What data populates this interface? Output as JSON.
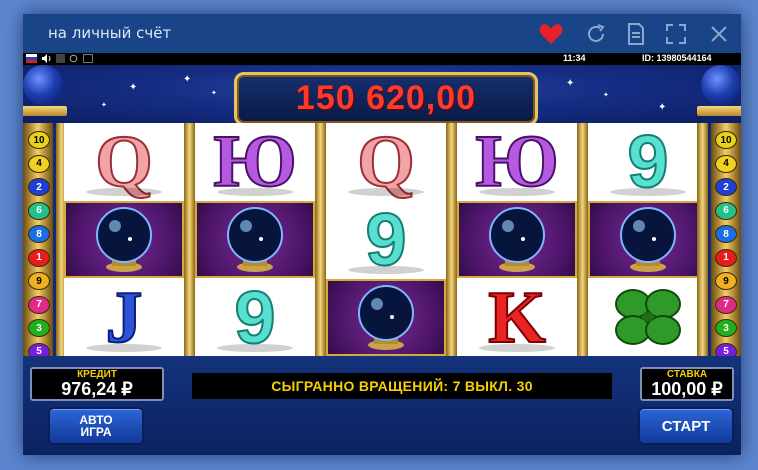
{
  "window": {
    "title": "на личный счёт",
    "icons": [
      "heart-icon",
      "refresh-icon",
      "document-icon",
      "fullscreen-icon",
      "close-icon"
    ],
    "heart_color": "#e8202a"
  },
  "statusbar": {
    "icons": [
      "russian-flag-icon",
      "sound-icon",
      "stop-icon",
      "reload-icon",
      "menu-icon"
    ],
    "time": "11:34",
    "id": "ID: 13980544164"
  },
  "game": {
    "jackpot": "150 620,00",
    "reels": [
      [
        "Q",
        "crystal-ball",
        "J"
      ],
      [
        "Ю",
        "crystal-ball",
        "9"
      ],
      [
        "Q",
        "9",
        "crystal-ball"
      ],
      [
        "Ю",
        "crystal-ball",
        "K"
      ],
      [
        "9",
        "crystal-ball",
        "four-leaf-clover"
      ]
    ],
    "paylines": [
      "10",
      "4",
      "2",
      "6",
      "8",
      "1",
      "9",
      "7",
      "3",
      "5"
    ],
    "payline_colors": {
      "10": "#e8d21c",
      "4": "#f0d020",
      "2": "#1f3fd8",
      "6": "#22c08a",
      "8": "#1a6fe8",
      "1": "#e81c1c",
      "9": "#f0b020",
      "7": "#e02a8a",
      "3": "#1fb020",
      "5": "#7a1ce0"
    }
  },
  "panel": {
    "credit_label": "КРЕДИТ",
    "credit_value": "976,24 ₽",
    "message": "СЫГРАННО ВРАЩЕНИЙ: 7 ВЫКЛ. 30",
    "bet_label": "СТАВКА",
    "bet_value": "100,00 ₽",
    "auto_line1": "АВТО",
    "auto_line2": "ИГРА",
    "start_label": "СТАРТ"
  }
}
